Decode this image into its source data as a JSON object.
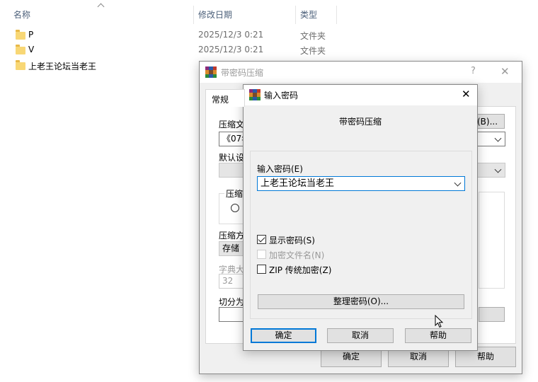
{
  "explorer": {
    "columns": {
      "name": "名称",
      "date": "修改日期",
      "type": "类型"
    },
    "rows": [
      {
        "name": "P",
        "date": "2025/12/3 0:21",
        "type": "文件夹"
      },
      {
        "name": "V",
        "date": "2025/12/3 0:21",
        "type": "文件夹"
      },
      {
        "name": "上老王论坛当老王",
        "date": "",
        "type": ""
      }
    ]
  },
  "back_dialog": {
    "title": "带密码压缩",
    "help": "?",
    "close": "✕",
    "tab": "常规",
    "archive_label": "压缩文",
    "archive_value": "《07年",
    "browse": "(B)...",
    "profile_label": "默认设",
    "format_group": "压缩",
    "method_label": "压缩方",
    "method_value": "存储",
    "dict_label": "字典大",
    "dict_value": "32",
    "split_label": "切分为",
    "ok": "确定",
    "cancel": "取消",
    "help_btn": "帮助"
  },
  "front_dialog": {
    "title": "输入密码",
    "close": "✕",
    "heading": "带密码压缩",
    "password_label": "输入密码(E)",
    "password_value": "上老王论坛当老王",
    "show_password": {
      "label": "显示密码(S)",
      "checked": true
    },
    "encrypt_names": {
      "label": "加密文件名(N)",
      "checked": false,
      "disabled": true
    },
    "zip_legacy": {
      "label": "ZIP 传统加密(Z)",
      "checked": false
    },
    "organize": "整理密码(O)...",
    "ok": "确定",
    "cancel": "取消",
    "help": "帮助"
  },
  "colors": {
    "accent": "#0078d7",
    "dialog_bg": "#f0f0f0"
  }
}
